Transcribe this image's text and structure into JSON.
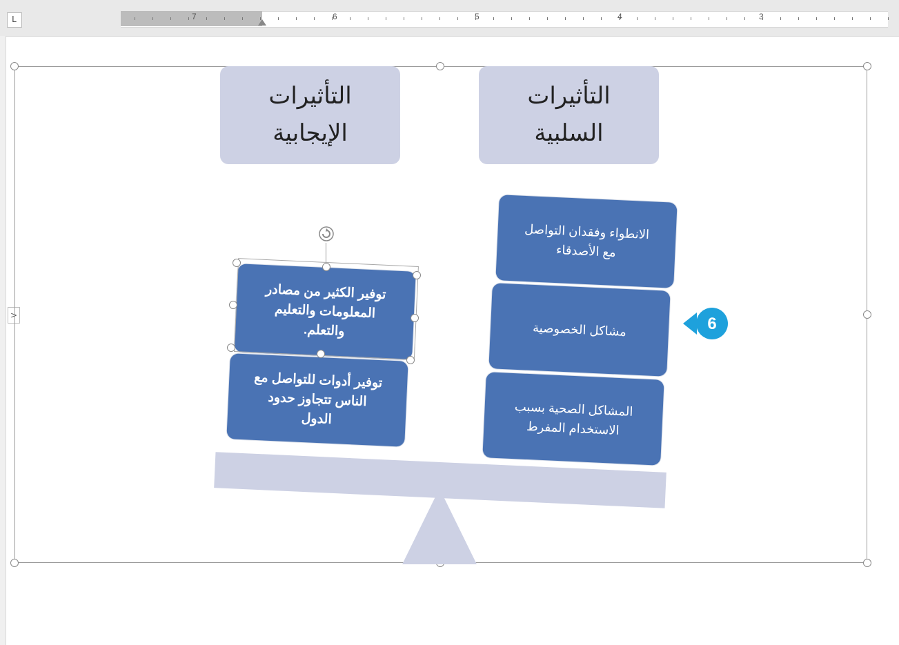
{
  "ruler": {
    "tab_selector": "L",
    "numbers": [
      "7",
      "6",
      "5",
      "4",
      "3"
    ]
  },
  "diagram": {
    "header_positive": {
      "line1": "التأثيرات",
      "line2": "الإيجابية"
    },
    "header_negative": {
      "line1": "التأثيرات",
      "line2": "السلبية"
    },
    "positive_items": [
      {
        "lines": [
          "توفير الكثير من مصادر",
          "المعلومات والتعليم",
          "والتعلم."
        ]
      },
      {
        "lines": [
          "توفير أدوات للتواصل مع",
          "الناس تتجاوز حدود",
          "الدول"
        ]
      }
    ],
    "negative_items": [
      {
        "lines": [
          "الانطواء وفقدان التواصل",
          "مع الأصدقاء"
        ]
      },
      {
        "lines": [
          "مشاكل الخصوصية"
        ]
      },
      {
        "lines": [
          "المشاكل الصحية بسبب",
          "الاستخدام المفرط"
        ]
      }
    ]
  },
  "callout": {
    "number": "6",
    "color": "#1ea1dc"
  },
  "colors": {
    "box_blue": "#4a73b4",
    "header_lavender": "#cdd1e4"
  },
  "pane_toggle": ">"
}
